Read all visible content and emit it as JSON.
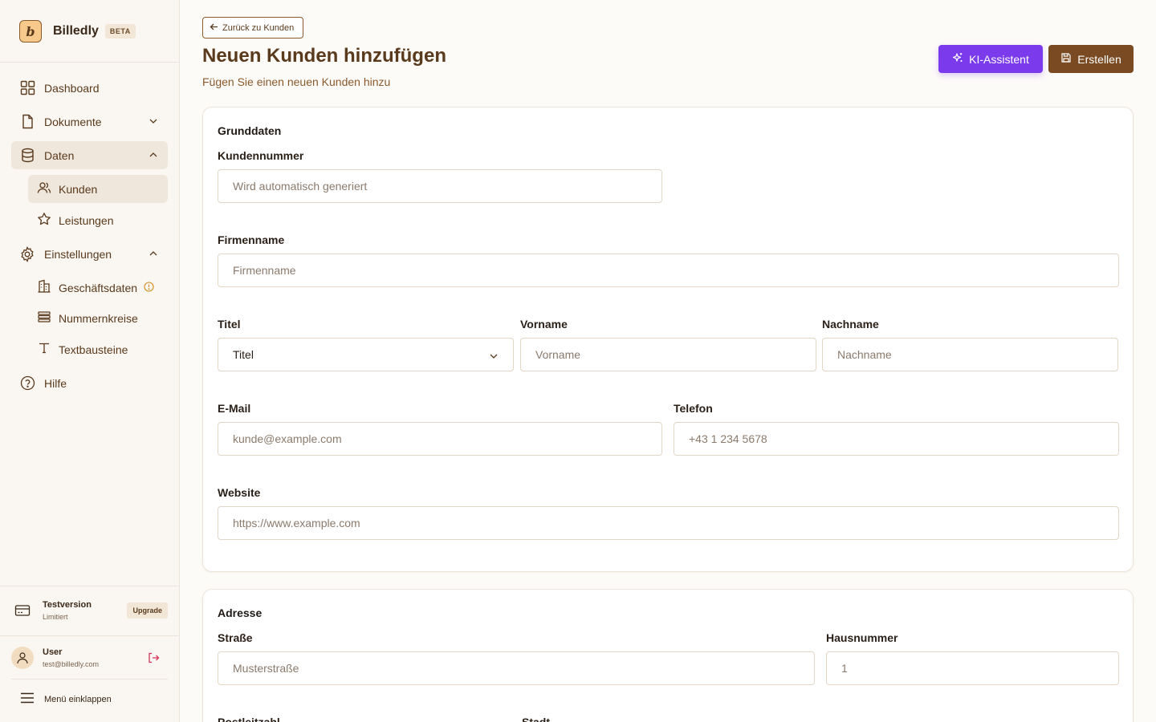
{
  "brand": {
    "name": "Billedly",
    "badge": "BETA",
    "logo_letter": "b"
  },
  "sidebar": {
    "items": [
      {
        "label": "Dashboard",
        "icon": "grid-icon"
      },
      {
        "label": "Dokumente",
        "icon": "document-icon"
      },
      {
        "label": "Daten",
        "icon": "database-icon"
      },
      {
        "label": "Kunden",
        "icon": "users-icon"
      },
      {
        "label": "Leistungen",
        "icon": "star-icon"
      },
      {
        "label": "Einstellungen",
        "icon": "gear-icon"
      },
      {
        "label": "Geschäftsdaten",
        "icon": "building-icon"
      },
      {
        "label": "Nummernkreise",
        "icon": "list-icon"
      },
      {
        "label": "Textbausteine",
        "icon": "text-icon"
      },
      {
        "label": "Hilfe",
        "icon": "help-icon"
      }
    ],
    "trial": {
      "title": "Testversion",
      "subtitle": "Limitiert",
      "upgrade_label": "Upgrade"
    },
    "user": {
      "name": "User",
      "email": "test@billedly.com"
    },
    "collapse_label": "Menü einklappen"
  },
  "header": {
    "back_label": "Zurück zu Kunden",
    "title": "Neuen Kunden hinzufügen",
    "subtitle": "Fügen Sie einen neuen Kunden hinzu",
    "ai_label": "KI-Assistent",
    "create_label": "Erstellen"
  },
  "colors": {
    "accent": "#7a4b22",
    "ai": "#7c3aed",
    "warning": "#d08a1e"
  },
  "form": {
    "basic": {
      "title": "Grunddaten",
      "customer_number": {
        "label": "Kundennummer",
        "placeholder": "Wird automatisch generiert"
      },
      "company": {
        "label": "Firmenname",
        "placeholder": "Firmenname"
      },
      "title_field": {
        "label": "Titel",
        "value": "Titel"
      },
      "first_name": {
        "label": "Vorname",
        "placeholder": "Vorname"
      },
      "last_name": {
        "label": "Nachname",
        "placeholder": "Nachname"
      },
      "email": {
        "label": "E-Mail",
        "placeholder": "kunde@example.com"
      },
      "phone": {
        "label": "Telefon",
        "placeholder": "+43 1 234 5678"
      },
      "website": {
        "label": "Website",
        "placeholder": "https://www.example.com"
      }
    },
    "address": {
      "title": "Adresse",
      "street": {
        "label": "Straße",
        "placeholder": "Musterstraße"
      },
      "house_number": {
        "label": "Hausnummer",
        "placeholder": "1"
      },
      "postal_code": {
        "label": "Postleitzahl"
      },
      "city": {
        "label": "Stadt"
      }
    }
  }
}
